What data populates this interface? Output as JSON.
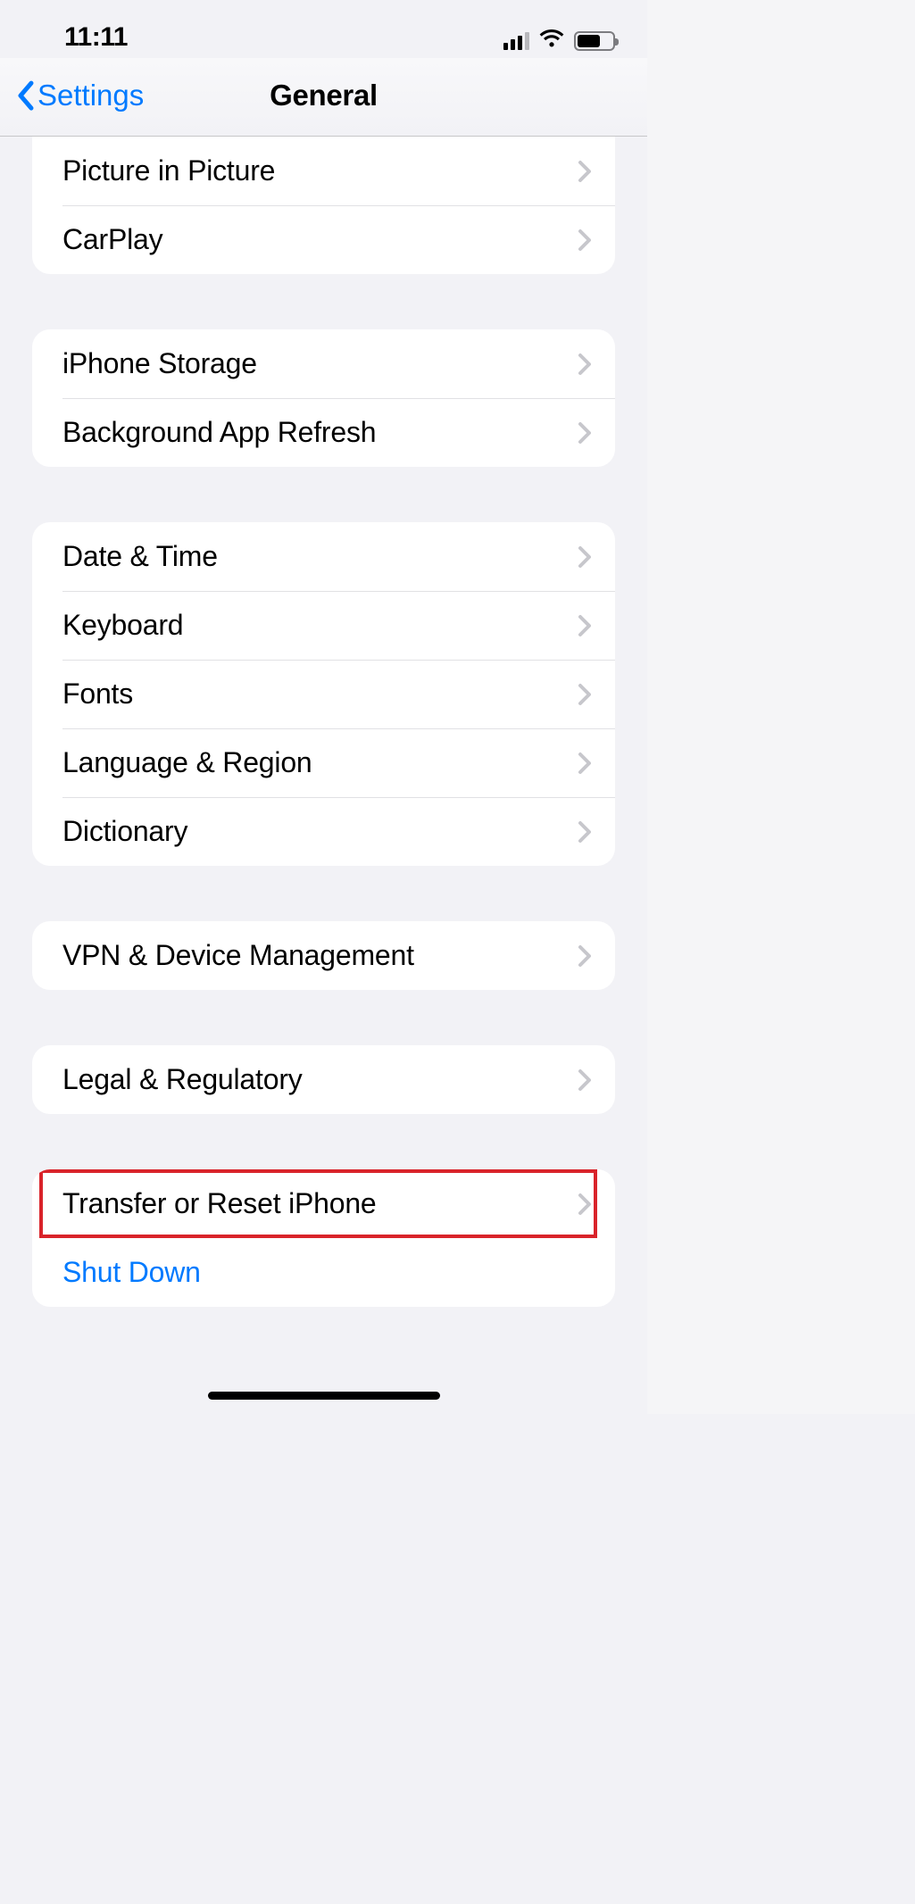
{
  "statusbar": {
    "time": "11:11"
  },
  "nav": {
    "back_label": "Settings",
    "title": "General"
  },
  "rows": {
    "pip": "Picture in Picture",
    "carplay": "CarPlay",
    "storage": "iPhone Storage",
    "bgrefresh": "Background App Refresh",
    "datetime": "Date & Time",
    "keyboard": "Keyboard",
    "fonts": "Fonts",
    "langregion": "Language & Region",
    "dictionary": "Dictionary",
    "vpn": "VPN & Device Management",
    "legal": "Legal & Regulatory",
    "transfer": "Transfer or Reset iPhone",
    "shutdown": "Shut Down"
  },
  "highlighted_row": "transfer"
}
